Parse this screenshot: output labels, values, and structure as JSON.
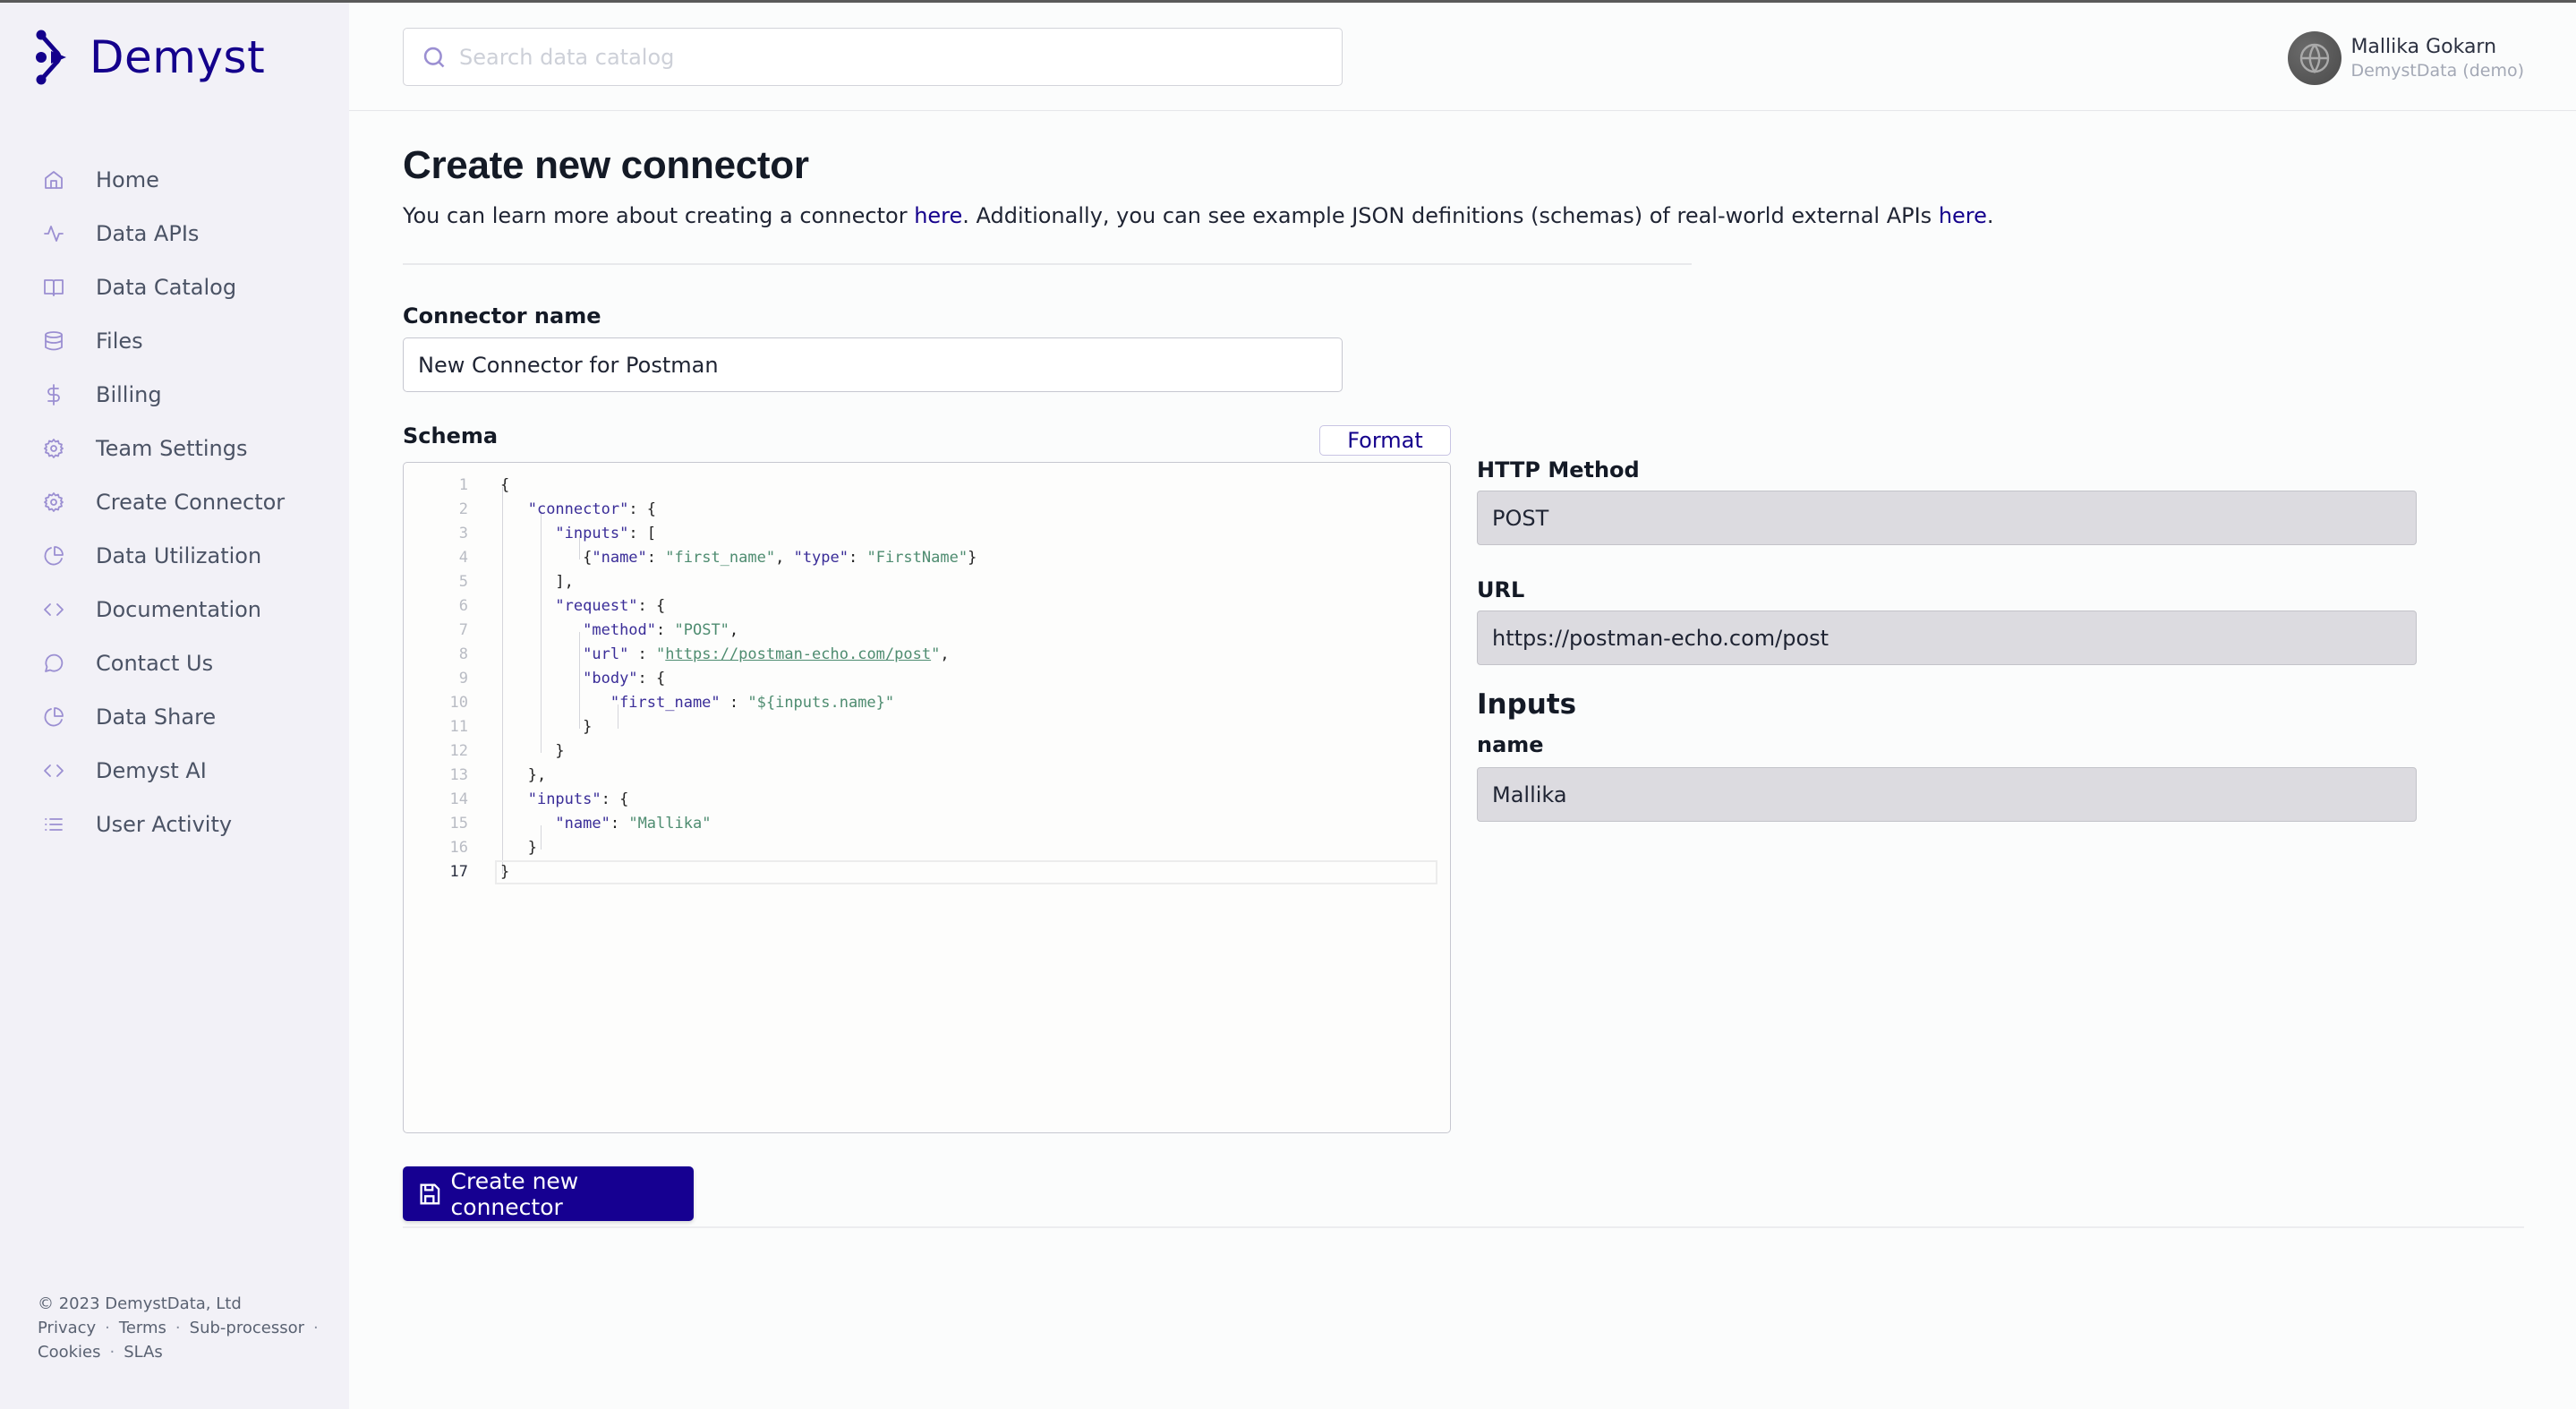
{
  "brand": {
    "name": "Demyst",
    "color": "#14008c"
  },
  "sidebar": {
    "items": [
      {
        "label": "Home",
        "icon": "home-icon"
      },
      {
        "label": "Data APIs",
        "icon": "activity-icon"
      },
      {
        "label": "Data Catalog",
        "icon": "book-icon"
      },
      {
        "label": "Files",
        "icon": "database-icon"
      },
      {
        "label": "Billing",
        "icon": "dollar-icon"
      },
      {
        "label": "Team Settings",
        "icon": "gear-icon"
      },
      {
        "label": "Create Connector",
        "icon": "gear-icon"
      },
      {
        "label": "Data Utilization",
        "icon": "pie-chart-icon"
      },
      {
        "label": "Documentation",
        "icon": "code-icon"
      },
      {
        "label": "Contact Us",
        "icon": "message-icon"
      },
      {
        "label": "Data Share",
        "icon": "pie-chart-icon"
      },
      {
        "label": "Demyst AI",
        "icon": "code-icon"
      },
      {
        "label": "User Activity",
        "icon": "list-icon"
      }
    ],
    "footer": {
      "copyright": "© 2023 DemystData, Ltd",
      "links": [
        "Privacy",
        "Terms",
        "Sub-processor",
        "Cookies",
        "SLAs"
      ]
    }
  },
  "header": {
    "search_placeholder": "Search data catalog",
    "user_name": "Mallika Gokarn",
    "user_org": "DemystData (demo)"
  },
  "page": {
    "title": "Create new connector",
    "intro_part1": "You can learn more about creating a connector ",
    "intro_link1": "here",
    "intro_part2": ". Additionally, you can see example JSON definitions (schemas) of real-world external APIs ",
    "intro_link2": "here",
    "intro_part3": "."
  },
  "form": {
    "connector_name_label": "Connector name",
    "connector_name_value": "New Connector for Postman",
    "schema_label": "Schema",
    "format_label": "Format",
    "create_label": "Create new connector"
  },
  "schema_lines": [
    "{",
    "    \"connector\": {",
    "        \"inputs\": [",
    "            {\"name\": \"first_name\", \"type\": \"FirstName\"}",
    "        ],",
    "        \"request\": {",
    "            \"method\": \"POST\",",
    "            \"url\" : \"https://postman-echo.com/post\",",
    "            \"body\": {",
    "                \"first_name\" : \"${inputs.name}\"",
    "            }",
    "        }",
    "    },",
    "    \"inputs\": {",
    "        \"name\": \"Mallika\"",
    "    }",
    "}"
  ],
  "active_line": 17,
  "preview": {
    "http_method_label": "HTTP Method",
    "http_method_value": "POST",
    "url_label": "URL",
    "url_value": "https://postman-echo.com/post",
    "inputs_heading": "Inputs",
    "input_name_label": "name",
    "input_name_value": "Mallika"
  }
}
